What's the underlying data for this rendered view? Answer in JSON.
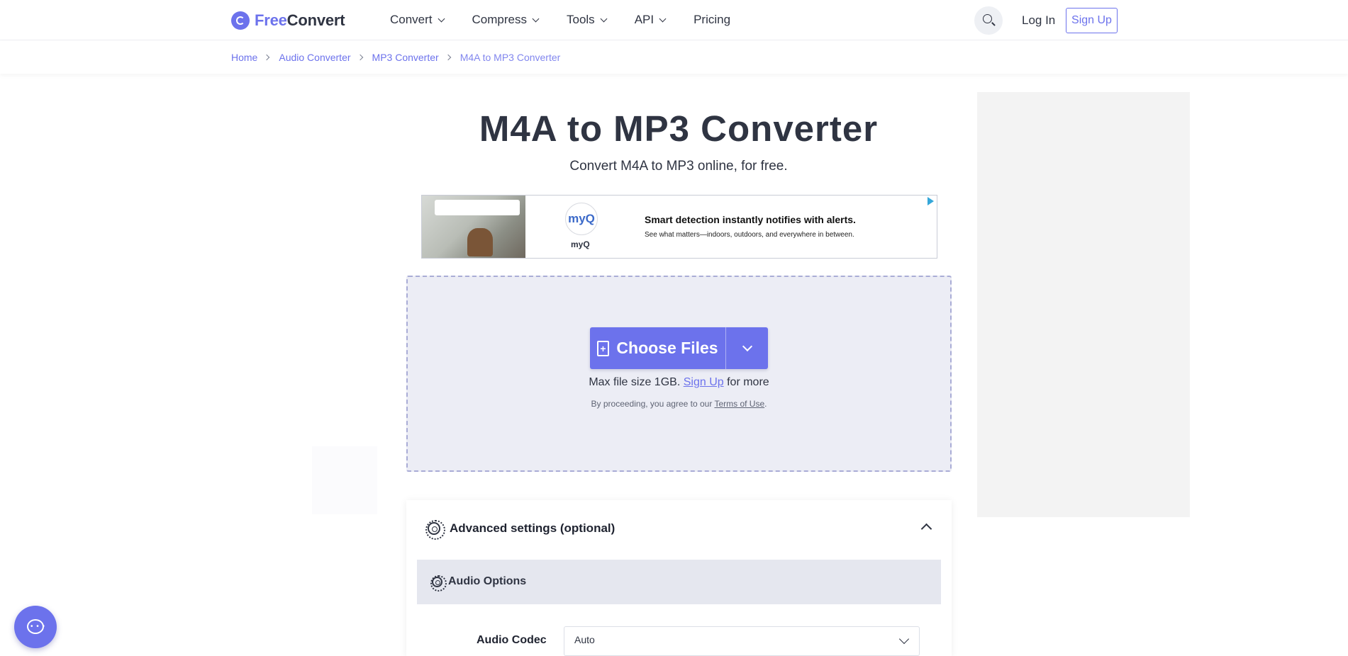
{
  "header": {
    "logo_free": "Free",
    "logo_convert": "Convert",
    "nav": [
      {
        "label": "Convert",
        "has_dropdown": true
      },
      {
        "label": "Compress",
        "has_dropdown": true
      },
      {
        "label": "Tools",
        "has_dropdown": true
      },
      {
        "label": "API",
        "has_dropdown": true
      },
      {
        "label": "Pricing",
        "has_dropdown": false
      }
    ],
    "search_icon": "search-icon",
    "login": "Log In",
    "signup": "Sign Up"
  },
  "breadcrumb": [
    "Home",
    "Audio Converter",
    "MP3 Converter",
    "M4A to MP3 Converter"
  ],
  "main": {
    "title": "M4A to MP3 Converter",
    "subtitle": "Convert M4A to MP3 online, for free."
  },
  "ad": {
    "logo": "myQ",
    "brand": "myQ",
    "headline": "Smart detection instantly notifies with alerts.",
    "body": "See what matters—indoors, outdoors, and everywhere in between."
  },
  "upload": {
    "button": "Choose Files",
    "max_prefix": "Max file size 1GB.",
    "max_link": "Sign Up",
    "max_suffix": "for more",
    "terms_prefix": "By proceeding, you agree to our",
    "terms_link": "Terms of Use",
    "terms_suffix": "."
  },
  "advanced": {
    "title": "Advanced settings (optional)",
    "audio_options": "Audio Options",
    "codec_label": "Audio Codec",
    "codec_value": "Auto"
  },
  "colors": {
    "accent": "#6c72ec",
    "text": "#2f3442",
    "dropzone": "#ecedf5"
  }
}
